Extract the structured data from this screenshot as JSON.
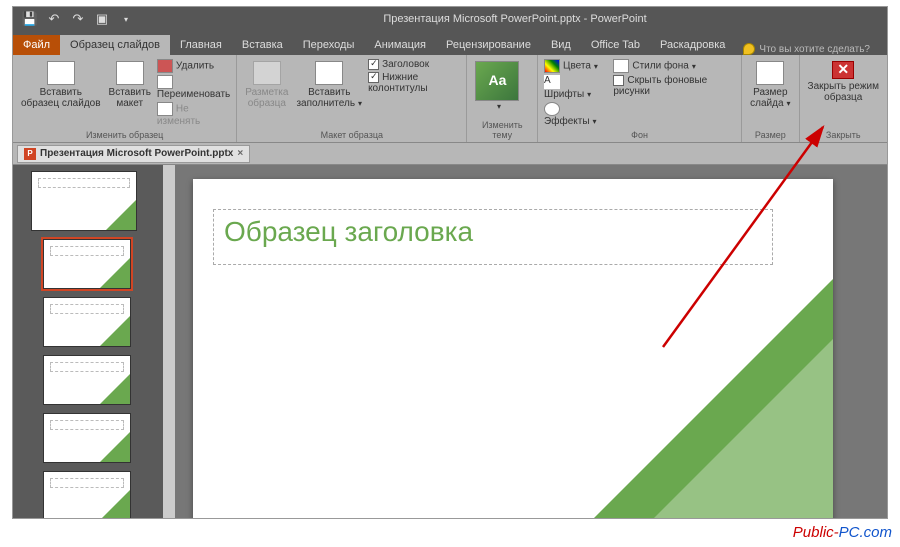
{
  "title": "Презентация Microsoft PowerPoint.pptx - PowerPoint",
  "tabs": {
    "file": "Файл",
    "master": "Образец слайдов",
    "home": "Главная",
    "insert": "Вставка",
    "transitions": "Переходы",
    "animation": "Анимация",
    "review": "Рецензирование",
    "view": "Вид",
    "office": "Office Tab",
    "storyboard": "Раскадровка"
  },
  "tellme": "Что вы хотите сделать?",
  "ribbon": {
    "g1": {
      "insertMaster": "Вставить\nобразец слайдов",
      "insertLayout": "Вставить\nмакет",
      "delete": "Удалить",
      "rename": "Переименовать",
      "keep": "Не изменять",
      "label": "Изменить образец"
    },
    "g2": {
      "masterLayout": "Разметка\nобразца",
      "insertPh": "Вставить\nзаполнитель",
      "title": "Заголовок",
      "footers": "Нижние колонтитулы",
      "label": "Макет образца"
    },
    "g3": {
      "label": "Изменить тему"
    },
    "g4": {
      "colors": "Цвета",
      "fonts": "Шрифты",
      "effects": "Эффекты",
      "bgStyles": "Стили фона",
      "hideBg": "Скрыть фоновые рисунки",
      "label": "Фон"
    },
    "g5": {
      "size": "Размер\nслайда",
      "label": "Размер"
    },
    "g6": {
      "close": "Закрыть режим\nобразца",
      "label": "Закрыть"
    }
  },
  "doctab": "Презентация Microsoft PowerPoint.pptx",
  "slide": {
    "titlePlaceholder": "Образец заголовка"
  },
  "watermark": {
    "p1": "Public-",
    "p2": "PC.com"
  }
}
